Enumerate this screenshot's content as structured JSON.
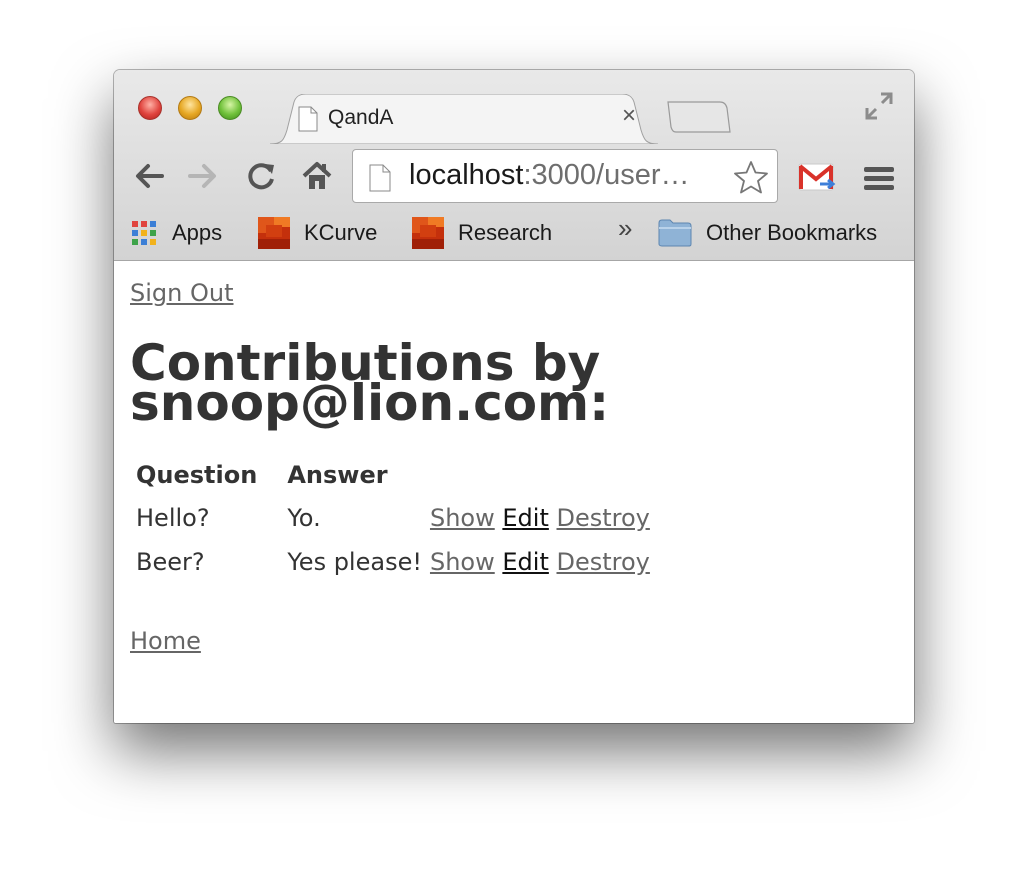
{
  "browser": {
    "tab_title": "QandA",
    "tab_close": "×",
    "url_host": "localhost",
    "url_rest": ":3000/user…",
    "bookmarks": [
      {
        "label": "Apps",
        "icon": "apps-grid-icon"
      },
      {
        "label": "KCurve",
        "icon": "bookmark-favicon-icon"
      },
      {
        "label": "Research",
        "icon": "bookmark-favicon-icon"
      },
      {
        "label": "Other Bookmarks",
        "icon": "folder-icon"
      }
    ],
    "bookmarks_overflow": "»"
  },
  "page": {
    "sign_out": "Sign Out",
    "heading": "Contributions by snoop@lion.com:",
    "columns": [
      "Question",
      "Answer"
    ],
    "rows": [
      {
        "question": "Hello?",
        "answer": "Yo.",
        "show": "Show",
        "edit": "Edit",
        "destroy": "Destroy"
      },
      {
        "question": "Beer?",
        "answer": "Yes please!",
        "show": "Show",
        "edit": "Edit",
        "destroy": "Destroy"
      }
    ],
    "home": "Home"
  },
  "colors": {
    "link": "#666666",
    "visited_link": "#111111",
    "text": "#333333"
  }
}
